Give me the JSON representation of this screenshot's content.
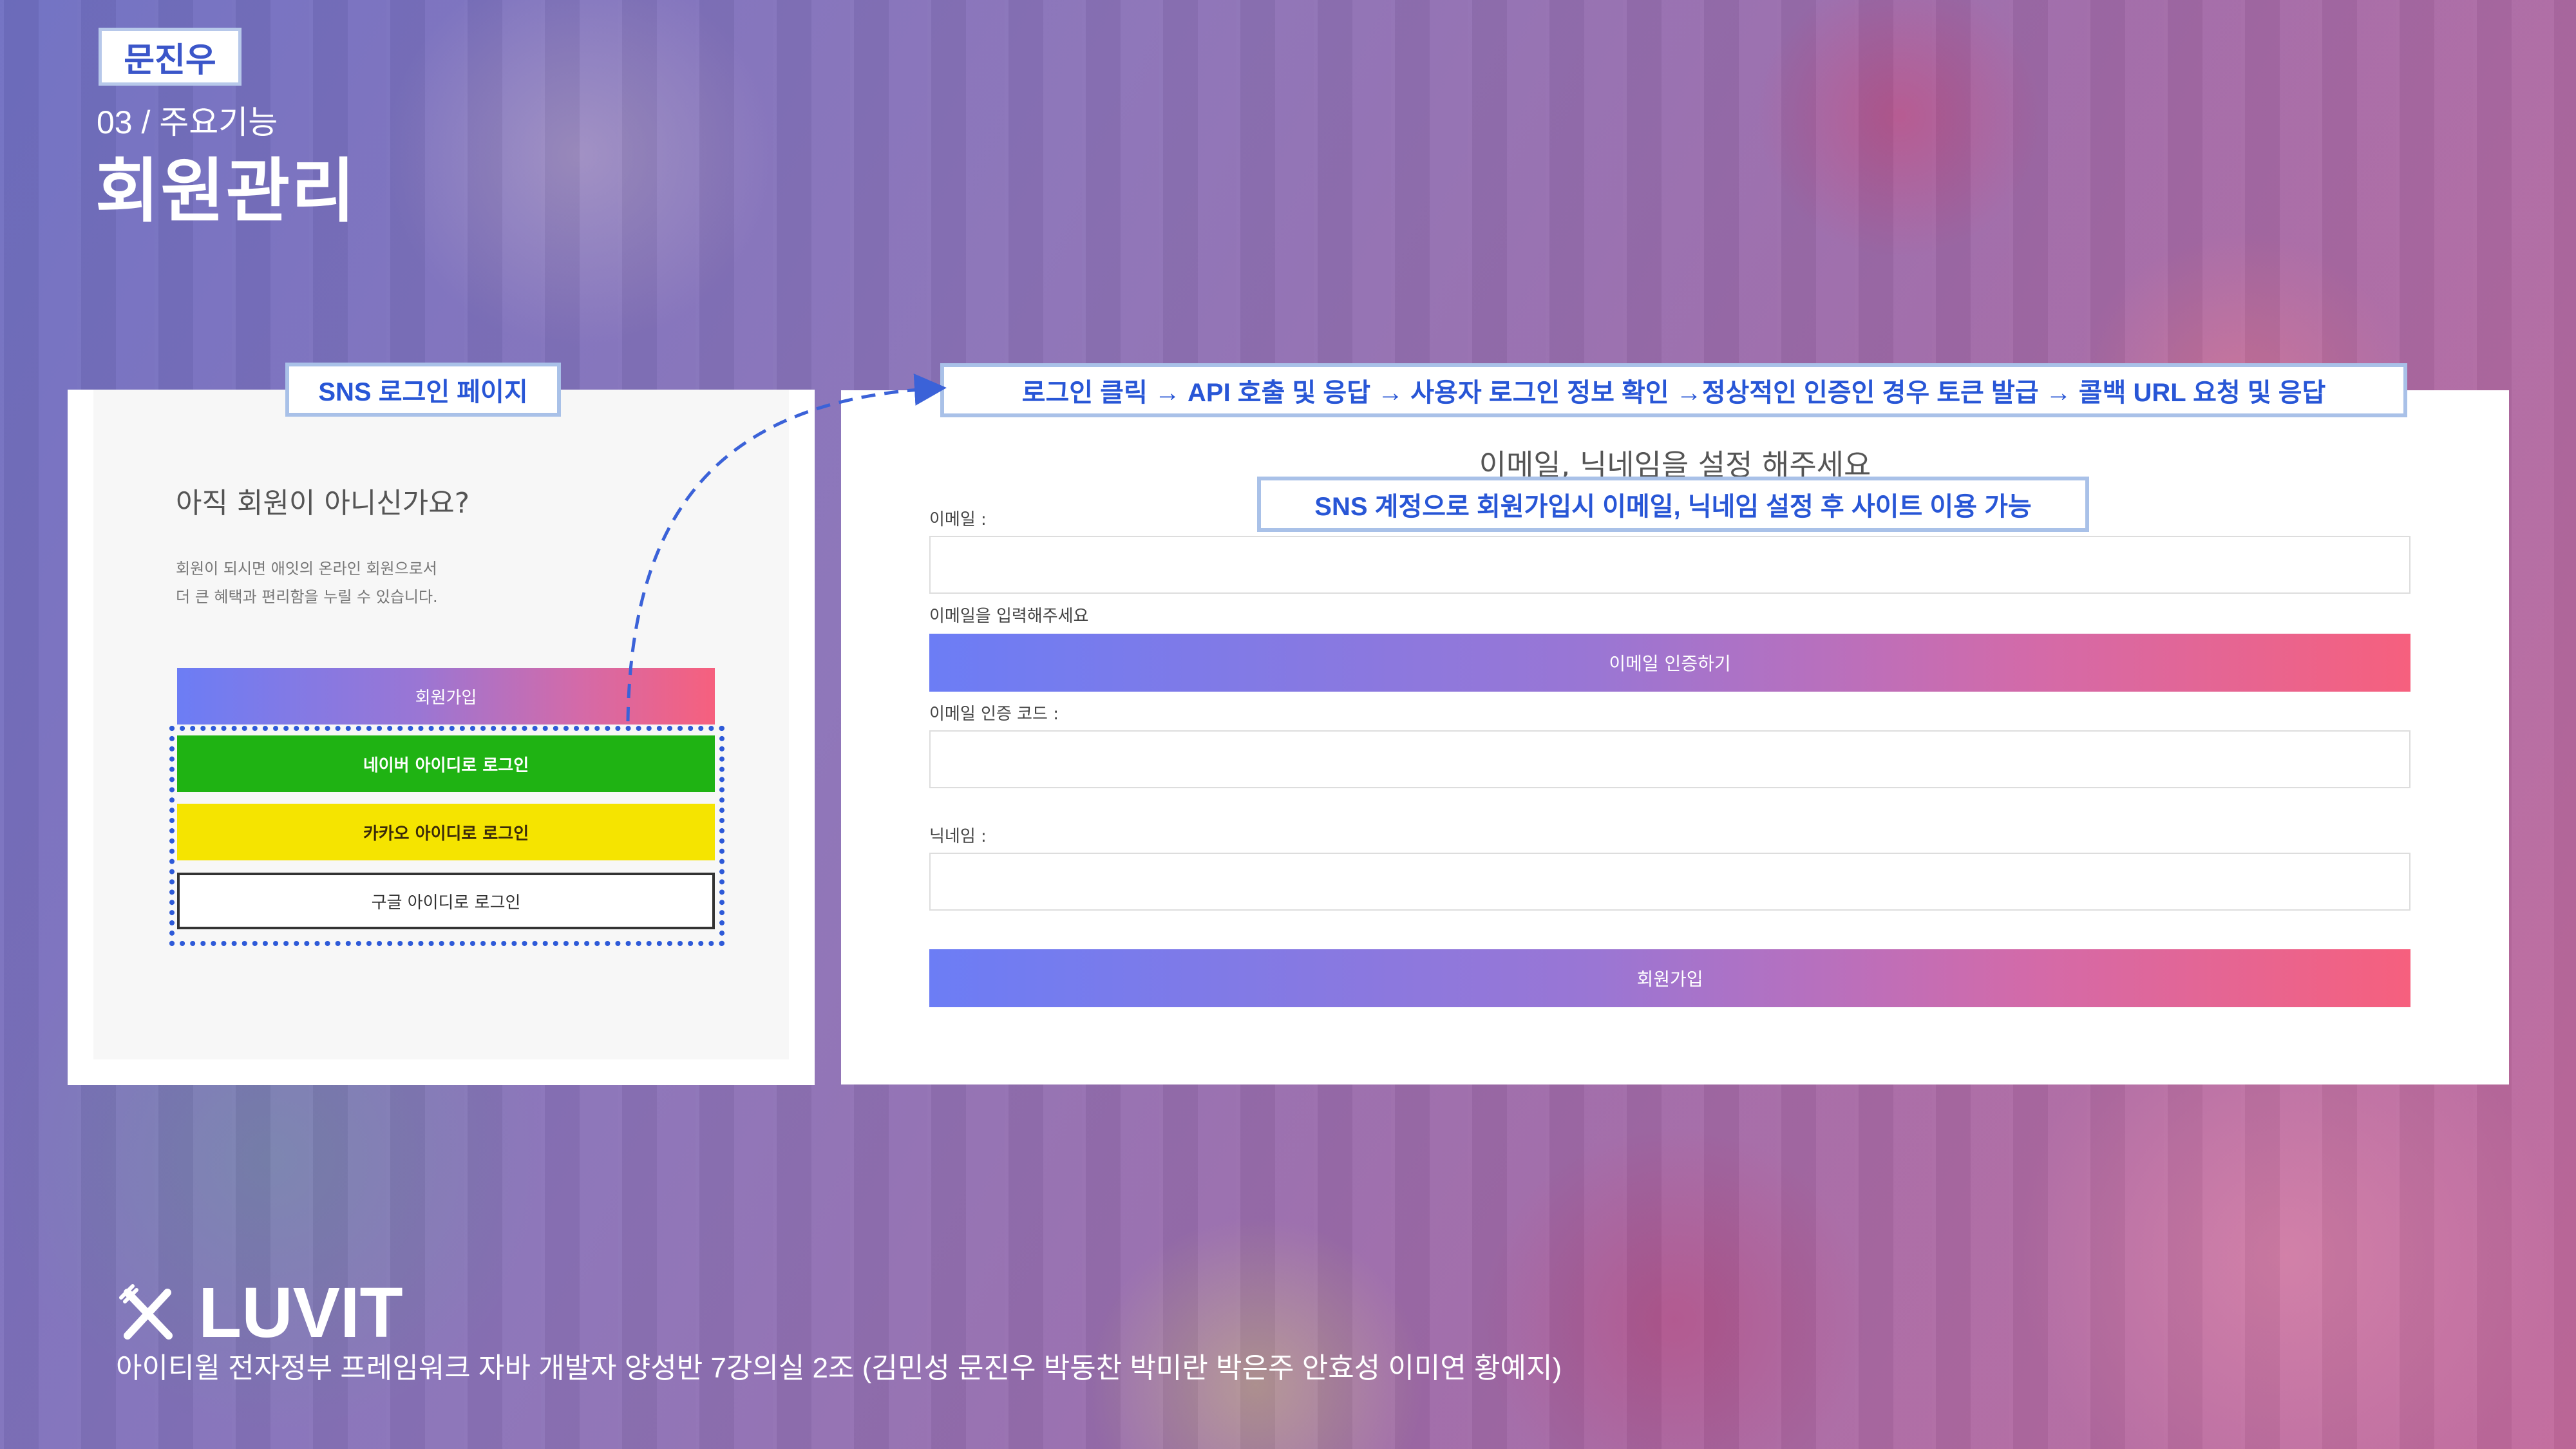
{
  "header": {
    "author": "문진우",
    "section_sub": "03 / 주요기능",
    "section_title": "회원관리"
  },
  "callouts": {
    "sns_login_page": "SNS 로그인 페이지",
    "flow": "로그인 클릭 → API 호출 및 응답 → 사용자 로그인 정보 확인 →정상적인 인증인 경우 토큰 발급 → 콜백 URL 요청 및 응답",
    "signup_note": "SNS 계정으로 회원가입시 이메일, 닉네임 설정 후 사이트 이용 가능"
  },
  "login_page": {
    "title": "아직 회원이 아니신가요?",
    "desc_line1": "회원이 되시면 애잇의 온라인 회원으로서",
    "desc_line2": "더 큰 혜택과 편리함을 누릴 수 있습니다.",
    "signup_button": "회원가입",
    "naver_button": "네이버 아이디로 로그인",
    "kakao_button": "카카오 아이디로 로그인",
    "google_button": "구글 아이디로 로그인",
    "colors": {
      "naver": "#1fb313",
      "kakao": "#f5e400"
    }
  },
  "signup_form": {
    "heading": "이메일, 닉네임을 설정 해주세요",
    "email_label": "이메일 :",
    "email_value": "",
    "email_hint": "이메일을 입력해주세요",
    "verify_button": "이메일 인증하기",
    "code_label": "이메일 인증 코드 :",
    "code_value": "",
    "nickname_label": "닉네임 :",
    "nickname_value": "",
    "submit_button": "회원가입",
    "gradient_colors": [
      "#6c7df5",
      "#f6607e"
    ]
  },
  "footer": {
    "brand": "LUVIT",
    "brand_icon": "crossed-utensils-icon",
    "caption": "아이티윌 전자정부 프레임워크 자바 개발자 양성반 7강의실 2조 (김민성 문진우 박동찬 박미란 박은주 안효성 이미연 황예지)"
  }
}
